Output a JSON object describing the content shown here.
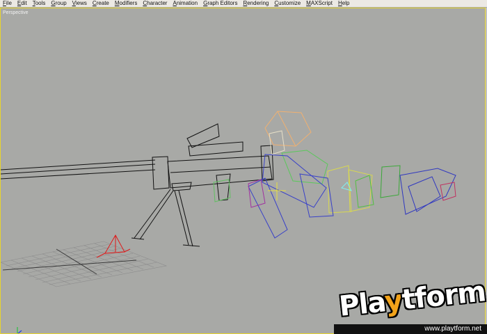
{
  "menu": {
    "items": [
      {
        "label": "File"
      },
      {
        "label": "Edit"
      },
      {
        "label": "Tools"
      },
      {
        "label": "Group"
      },
      {
        "label": "Views"
      },
      {
        "label": "Create"
      },
      {
        "label": "Modifiers"
      },
      {
        "label": "Character"
      },
      {
        "label": "Animation"
      },
      {
        "label": "Graph Editors"
      },
      {
        "label": "Rendering"
      },
      {
        "label": "Customize"
      },
      {
        "label": "MAXScript"
      },
      {
        "label": "Help"
      }
    ]
  },
  "viewport": {
    "label": "Perspective",
    "active_border_color": "#e8d52a",
    "background_color": "#a8a9a6"
  },
  "watermark": {
    "brand_part1": "Pla",
    "brand_part2": "y",
    "brand_part3": "tform",
    "url": "www.playtform.net"
  },
  "icons": {
    "axis": "axis-tripod-icon"
  }
}
